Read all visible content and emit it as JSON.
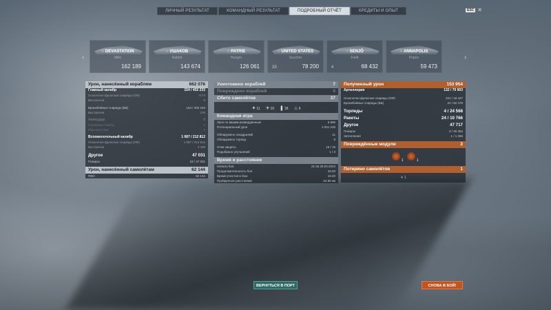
{
  "tabs": [
    {
      "label": "ЛИЧНЫЙ РЕЗУЛЬТАТ",
      "active": false
    },
    {
      "label": "КОМАНДНЫЙ РЕЗУЛЬТАТ",
      "active": false
    },
    {
      "label": "ПОДРОБНЫЙ ОТЧЁТ",
      "active": true
    },
    {
      "label": "КРЕДИТЫ И ОПЫТ",
      "active": false
    }
  ],
  "close": {
    "key": "ESC",
    "icon": "close-icon"
  },
  "ships": [
    {
      "name": "DEVASTATION",
      "player": "Milki",
      "damage": "162 189",
      "kills": ""
    },
    {
      "name": "УШАКОВ",
      "player": "Rabbit",
      "damage": "143 674",
      "kills": ""
    },
    {
      "name": "PATRIE",
      "player": "Huegro",
      "damage": "126 061",
      "kills": ""
    },
    {
      "name": "UNITED STATES",
      "player": "Soucher",
      "damage": "78 200",
      "kills": "33"
    },
    {
      "name": "SENJŌ",
      "player": "Feldt",
      "damage": "68 432",
      "kills": "4"
    },
    {
      "name": "ANNAPOLIS",
      "player": "Popov",
      "damage": "59 473",
      "kills": ""
    }
  ],
  "left": {
    "ship_damage": {
      "label": "Урон, нанесённый кораблям",
      "value": "662 076"
    },
    "main_caliber": {
      "label": "Главный калибр",
      "value": "154 / 402 233"
    },
    "mc_rows": [
      {
        "label": "Осколочно-фугасные снаряды (ОФ)",
        "value": "0 / 0"
      },
      {
        "label": "Выстрелов",
        "value": "0"
      }
    ],
    "mc_ap": {
      "label": "Бронебойные снаряды (ББ)",
      "value": "154 / 402 233"
    },
    "mc_ap_shots": {
      "label": "Выстрелов",
      "value": "276"
    },
    "aviation": {
      "label": "Авиаудар",
      "value": "0"
    },
    "av_rows": [
      {
        "label": "Глубинные бомбы",
        "value": "0"
      },
      {
        "label": "Обычного боя",
        "value": "0"
      }
    ],
    "secondary": {
      "label": "Вспомогательный калибр",
      "value": "1 087 / 212 812"
    },
    "sec_rows": [
      {
        "label": "Осколочно-фугасные снаряды (ОФ)",
        "value": "1 087 / 212 812"
      },
      {
        "label": "Выстрелов",
        "value": "3 408"
      }
    ],
    "other": {
      "label": "Другое",
      "value": "47 031"
    },
    "fires": {
      "label": "Пожары",
      "value": "18 / 47 031"
    },
    "plane_damage": {
      "label": "Урон, нанесённый самолётам",
      "value": "62 144"
    },
    "aa": {
      "label": "ПВО",
      "value": "62 144"
    }
  },
  "middle": {
    "ships_destroyed": {
      "label": "Уничтожено кораблей",
      "value": "7"
    },
    "ships_damaged": {
      "label": "Повреждено кораблей",
      "value": "0"
    },
    "planes_downed": {
      "label": "Сбито самолётов",
      "value": "37"
    },
    "ribbons": [
      {
        "icon": "hit-icon",
        "count": "11"
      },
      {
        "icon": "plane-icon",
        "count": "10"
      },
      {
        "icon": "shell-icon",
        "count": "18"
      },
      {
        "icon": "fire-icon",
        "count": "6"
      }
    ],
    "team_play": {
      "label": "Командная игра"
    },
    "team_rows": [
      {
        "label": "Урон по вашим разведданным",
        "value": "5 590"
      },
      {
        "label": "Потенциальный урон",
        "value": "2 001 248"
      },
      {
        "label": "Обнаружено эскадрилий",
        "value": "11"
      },
      {
        "label": "Обнаружено торпед",
        "value": "9"
      },
      {
        "label": "Очки защиты",
        "value": "15 / 15"
      },
      {
        "label": "Подобрано улучшений",
        "value": "1 / 3"
      }
    ],
    "time_dist": {
      "label": "Время и расстояние"
    },
    "time_rows": [
      {
        "label": "Начало боя",
        "value": "21:46  26.04.2024"
      },
      {
        "label": "Продолжительность боя",
        "value": "15:20"
      },
      {
        "label": "Время участия в бою",
        "value": "15:20"
      },
      {
        "label": "Пройденное расстояние",
        "value": "54.96 км"
      }
    ]
  },
  "right": {
    "received": {
      "label": "Полученный урон",
      "value": "153 954"
    },
    "artillery": {
      "label": "Артиллерия",
      "value": "132 / 70 903"
    },
    "art_rows": [
      {
        "label": "Осколочно-фугасные снаряды (ОФ)",
        "value": "101 / 18 427"
      },
      {
        "label": "Бронебойные снаряды (ББ)",
        "value": "31 / 52 476"
      }
    ],
    "torpedoes": {
      "label": "Торпеды",
      "value": "4 / 24 568"
    },
    "rockets": {
      "label": "Ракеты",
      "value": "24 / 10 766"
    },
    "other": {
      "label": "Другое",
      "value": "47 717"
    },
    "other_rows": [
      {
        "label": "Пожары",
        "value": "3 / 46 452"
      },
      {
        "label": "Затопления",
        "value": "1 / 1 265"
      }
    ],
    "modules": {
      "label": "Повреждённые модули",
      "value": "2"
    },
    "module_icons": [
      {
        "icon": "engine-icon",
        "count": "1"
      },
      {
        "icon": "steering-icon",
        "count": "1"
      }
    ],
    "planes_lost": {
      "label": "Потеряно самолётов",
      "value": "1"
    },
    "planes_lost_icon": {
      "icon": "plane-icon",
      "count": "1"
    }
  },
  "buttons": {
    "port": "ВЕРНУТЬСЯ В ПОРТ",
    "again": "СНОВА В БОЙ!"
  }
}
